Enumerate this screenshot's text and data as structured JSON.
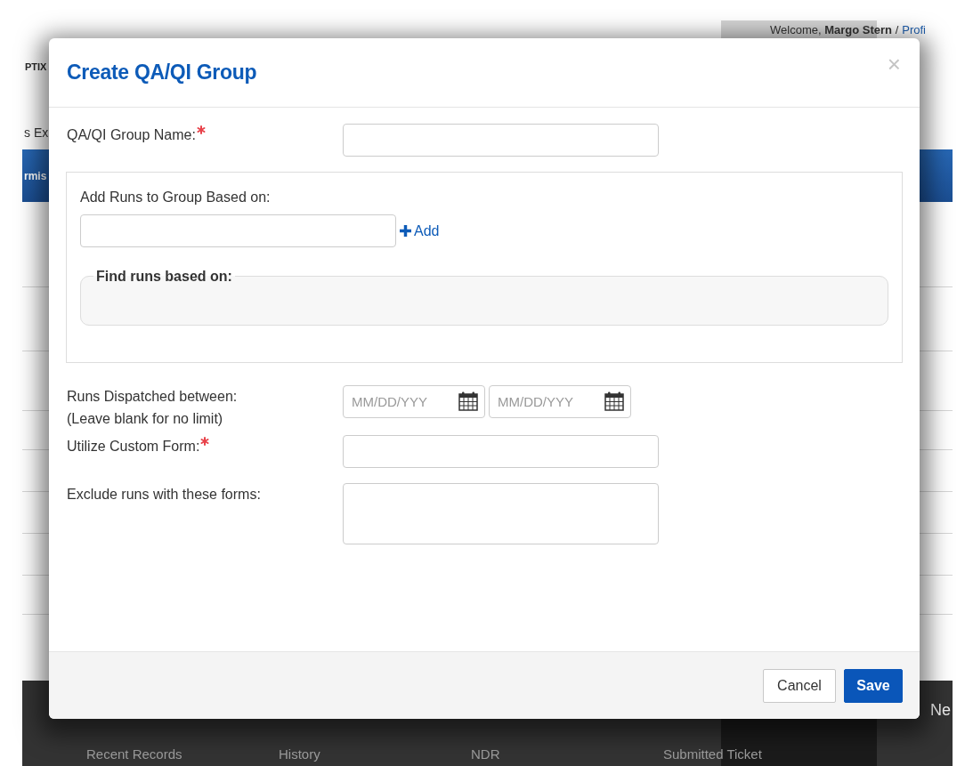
{
  "background_page": {
    "brand": "PTIX",
    "welcome": "Welcome, **Margo Stern** /",
    "profile_link": "Profi",
    "menu_text": "s Ex",
    "banner_text": "rmis",
    "nav_text": "Ne",
    "footer_links": [
      "Recent Records",
      "History",
      "NDR",
      "Submitted Ticket"
    ]
  },
  "dialog": {
    "title": "Create QA/QI Group",
    "close": "×",
    "rows": [
      {
        "kind": "text",
        "label": "QA/QI Group Name:",
        "required": true
      },
      {
        "kind": "group",
        "label": "Add Runs to Group Based on:",
        "required": false,
        "add_link": "Add",
        "panel_legend": "Find runs based on:"
      },
      {
        "kind": "date_range",
        "label": "Runs Dispatched between:",
        "required": false,
        "hint": "(Leave blank for no limit)",
        "placeholders": [
          "MM/DD/YYY",
          "MM/DD/YYY"
        ]
      },
      {
        "kind": "text",
        "label": "Utilize Custom Form:",
        "required": true
      },
      {
        "kind": "textarea",
        "label": "Exclude runs with these forms:",
        "required": false
      }
    ],
    "buttons": [
      {
        "label": "Cancel",
        "kind": "secondary"
      },
      {
        "label": "Save",
        "kind": "primary"
      }
    ]
  }
}
